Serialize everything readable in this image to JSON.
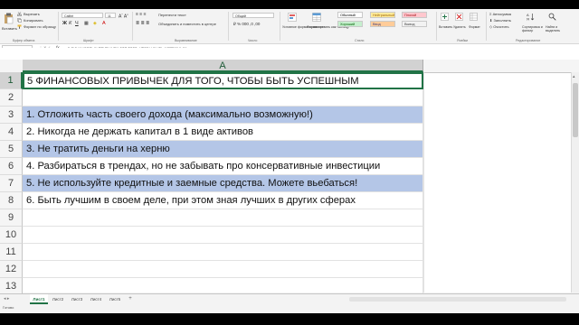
{
  "ribbon": {
    "paste_label": "Вставить",
    "cut_label": "Вырезать",
    "copy_label": "Копировать",
    "format_painter_label": "Формат по образцу",
    "font_name": "Calibri",
    "font_size": "11",
    "wrap_text_label": "Перенести текст",
    "merge_label": "Объединить и поместить в центре",
    "number_format": "Общий",
    "conditional_label": "Условное форматирование",
    "format_as_table_label": "Форматировать как таблицу",
    "styles": [
      "Обычный",
      "Нейтральный",
      "Плохой",
      "Хороший",
      "Ввод",
      "Вывод"
    ],
    "insert_label": "Вставить",
    "delete_label": "Удалить",
    "format_label": "Формат",
    "autosum_label": "Автосумма",
    "fill_label": "Заполнить",
    "clear_label": "Очистить",
    "sort_label": "Сортировка и фильтр",
    "find_label": "Найти и выделить",
    "groups": {
      "clipboard": "Буфер обмена",
      "font": "Шрифт",
      "alignment": "Выравнивание",
      "number": "Число",
      "styles": "Стили",
      "cells": "Ячейки",
      "editing": "Редактирование"
    }
  },
  "formula_bar": {
    "name_box": "A1",
    "fx": "fx",
    "formula": "5 ФИНАНСОВЫХ ПРИВЫЧЕК ДЛЯ ТОГО, ЧТОБЫ БЫТЬ УСПЕШНЫМ"
  },
  "grid": {
    "column_header": "A",
    "rows": [
      {
        "num": "1",
        "text": "5 ФИНАНСОВЫХ ПРИВЫЧЕК ДЛЯ ТОГО, ЧТОБЫ БЫТЬ УСПЕШНЫМ"
      },
      {
        "num": "2",
        "text": ""
      },
      {
        "num": "3",
        "text": "1. Отложить часть своего дохода (максимально возможную!)"
      },
      {
        "num": "4",
        "text": "2. Никогда не держать капитал в 1 виде активов"
      },
      {
        "num": "5",
        "text": "3. Не тратить деньги на херню"
      },
      {
        "num": "6",
        "text": "4. Разбираться в трендах, но не забывать про консервативные инвестиции"
      },
      {
        "num": "7",
        "text": "5. Не используйте кредитные и заемные средства. Можете вьебаться!"
      },
      {
        "num": "8",
        "text": "6. Быть лучшим в своем деле, при этом зная лучших в других сферах"
      },
      {
        "num": "9",
        "text": ""
      },
      {
        "num": "10",
        "text": ""
      },
      {
        "num": "11",
        "text": ""
      },
      {
        "num": "12",
        "text": ""
      },
      {
        "num": "13",
        "text": ""
      }
    ]
  },
  "sheets": [
    "Лист1",
    "Лист2",
    "Лист3",
    "Лист4",
    "Лист5"
  ],
  "add_sheet": "+",
  "status": "Готово",
  "colors": {
    "accent": "#217346",
    "highlight": "#b4c6e7"
  }
}
